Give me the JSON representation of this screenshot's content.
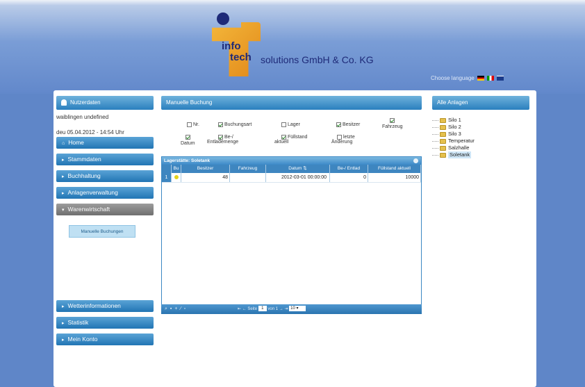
{
  "header": {
    "logo_info": "info",
    "logo_tech": "tech",
    "logo_rest": "solutions GmbH & Co. KG",
    "language_label": "Choose language"
  },
  "left": {
    "user_header": "Nutzerdaten",
    "user_line1": "waiblingen undefined",
    "user_line2": "deu 05.04.2012 - 14:54 Uhr",
    "nav": [
      {
        "label": "Home"
      },
      {
        "label": "Stammdaten"
      },
      {
        "label": "Buchhaltung"
      },
      {
        "label": "Anlagenverwaltung"
      },
      {
        "label": "Warenwirtschaft"
      }
    ],
    "sub_item": "Manuelle Buchungen",
    "nav_bottom": [
      {
        "label": "Wetterinformationen"
      },
      {
        "label": "Statistik"
      },
      {
        "label": "Mein Konto"
      }
    ]
  },
  "center": {
    "header": "Manuelle Buchung",
    "fields": {
      "nr": "Nr.",
      "buchungsart": "Buchungsart",
      "lager": "Lager",
      "besitzer": "Besitzer",
      "fahrzeug": "Fahrzeug",
      "datum": "Datum",
      "entlademenge_1": "Be-/",
      "entlademenge_2": "Entlademenge",
      "fuellstand_1": "Füllstand",
      "fuellstand_2": "aktuell",
      "letzte_1": "letzte",
      "letzte_2": "Änderung"
    },
    "grid": {
      "caption": "Lagerstätte: Soletank",
      "columns": [
        "Bu",
        "Besitzer",
        "Fahrzeug",
        "Datum",
        "Be-/ Entlad",
        "Füllstand aktuell"
      ],
      "rows": [
        {
          "num": "1",
          "besitzer": "48",
          "fahrzeug": "",
          "datum": "2012-03-01 00:00:00",
          "entlad": "0",
          "fuellstand": "10000"
        }
      ],
      "pager": {
        "page_label": "Seite",
        "page_value": "1",
        "of_label": "von 1",
        "page_size": "10"
      }
    }
  },
  "right": {
    "header": "Alle Anlagen",
    "tree": [
      "Silo 1",
      "Silo 2",
      "Silo 3",
      "Temperatur",
      "Salzhalle",
      "Soletank"
    ],
    "selected": "Soletank"
  }
}
